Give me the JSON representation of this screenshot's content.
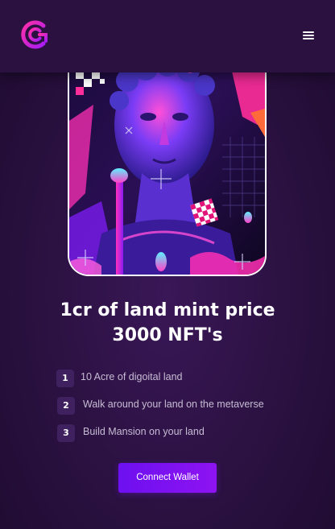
{
  "brand": {
    "logo_icon": "brand-logo-icon",
    "accent": "#7d12f2"
  },
  "header": {
    "menu_icon": "hamburger-menu-icon"
  },
  "hero": {
    "image": "nft-artwork-image",
    "title_line1": "1cr of land mint price",
    "title_line2": "3000 NFT's"
  },
  "features": [
    {
      "number": "1",
      "text": "10 Acre of digoital land"
    },
    {
      "number": "2",
      "text": "Walk around your land on the metaverse"
    },
    {
      "number": "3",
      "text": "Build Mansion on your land"
    }
  ],
  "cta": {
    "label": "Connect Wallet"
  }
}
